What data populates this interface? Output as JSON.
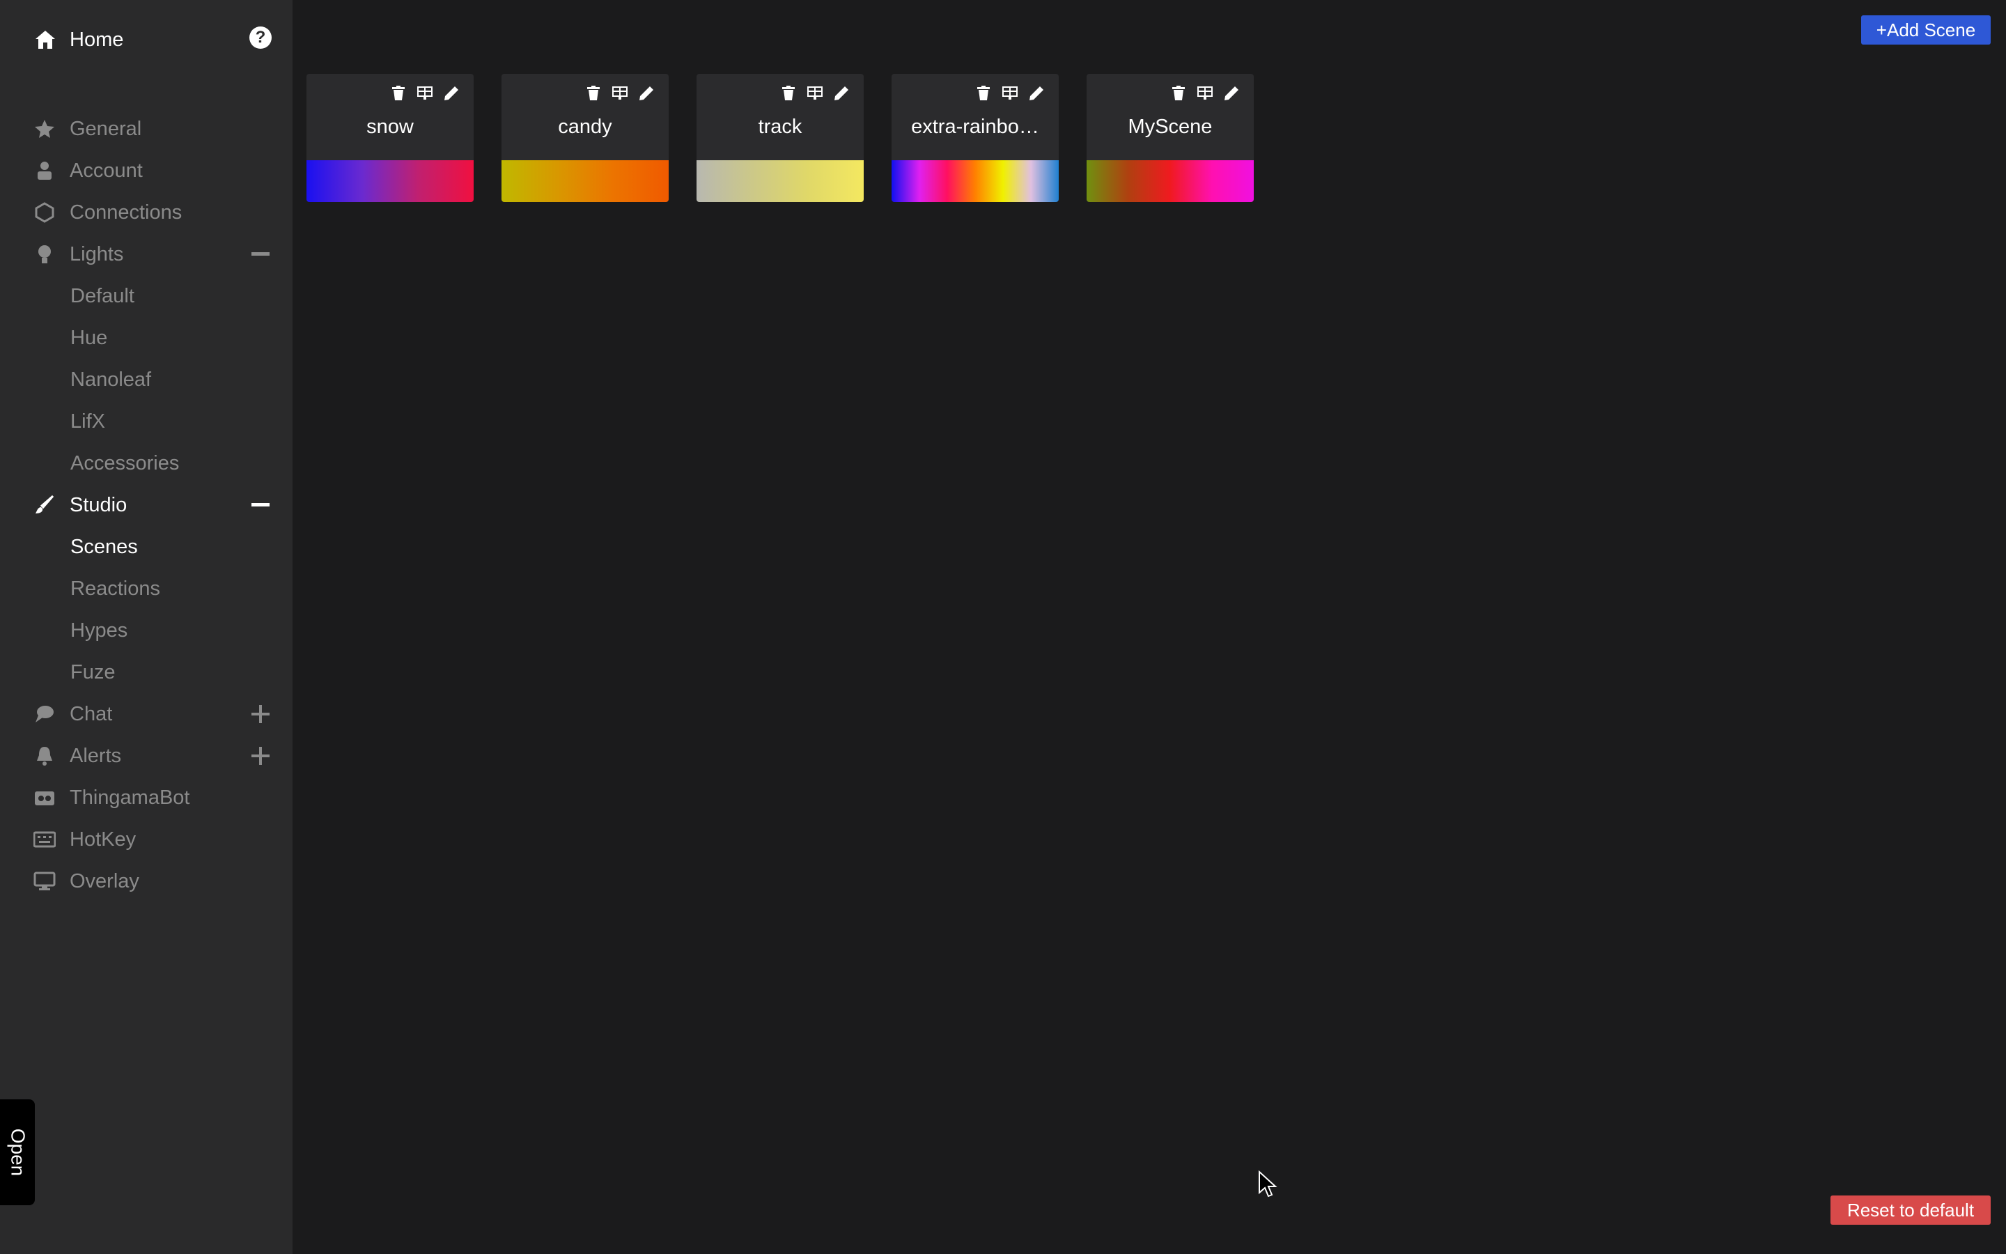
{
  "sidebar": {
    "home_label": "Home",
    "items": [
      {
        "label": "General",
        "icon": "star-icon"
      },
      {
        "label": "Account",
        "icon": "user-icon"
      },
      {
        "label": "Connections",
        "icon": "connections-icon"
      },
      {
        "label": "Lights",
        "icon": "lightbulb-icon",
        "toggle": "minus"
      },
      {
        "label": "Studio",
        "icon": "brush-icon",
        "toggle": "minus"
      },
      {
        "label": "Chat",
        "icon": "chat-icon",
        "toggle": "plus"
      },
      {
        "label": "Alerts",
        "icon": "bell-icon",
        "toggle": "plus"
      },
      {
        "label": "ThingamaBot",
        "icon": "robot-icon"
      },
      {
        "label": "HotKey",
        "icon": "keyboard-icon"
      },
      {
        "label": "Overlay",
        "icon": "monitor-icon"
      }
    ],
    "lights_sub": [
      "Default",
      "Hue",
      "Nanoleaf",
      "LifX",
      "Accessories"
    ],
    "studio_sub": [
      "Scenes",
      "Reactions",
      "Hypes",
      "Fuze"
    ],
    "open_tab": "Open"
  },
  "main": {
    "add_scene_label": "+Add Scene",
    "reset_label": "Reset to default",
    "scenes": [
      {
        "name": "snow",
        "gradient": [
          "#1a10f0",
          "#6a2ad0",
          "#c02070",
          "#f01040"
        ]
      },
      {
        "name": "candy",
        "gradient": [
          "#c0b800",
          "#d89800",
          "#ec7400",
          "#f05a00"
        ]
      },
      {
        "name": "track",
        "gradient": [
          "#b8b8b0",
          "#ccc888",
          "#e0d868",
          "#f4e860"
        ]
      },
      {
        "name": "extra-rainbo…",
        "gradient": [
          "#1010f0",
          "#e020f0",
          "#ff1060",
          "#ff8000",
          "#f0f000",
          "#e0c0e0",
          "#2080d0"
        ]
      },
      {
        "name": "MyScene",
        "gradient": [
          "#709010",
          "#b04010",
          "#f01a20",
          "#ff10b0",
          "#f010e0"
        ]
      }
    ]
  },
  "colors": {
    "background": "#1b1b1c",
    "sidebar": "#2a2a2b",
    "accent_blue": "#2e58d6",
    "danger_red": "#d84a4a"
  }
}
